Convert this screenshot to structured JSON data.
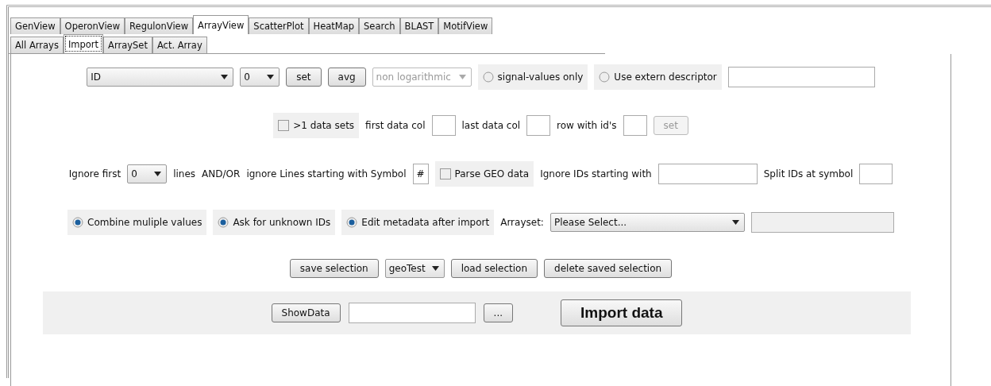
{
  "tabs": [
    {
      "label": "GenView",
      "selected": false
    },
    {
      "label": "OperonView",
      "selected": false
    },
    {
      "label": "RegulonView",
      "selected": false
    },
    {
      "label": "ArrayView",
      "selected": true
    },
    {
      "label": "ScatterPlot",
      "selected": false
    },
    {
      "label": "HeatMap",
      "selected": false
    },
    {
      "label": "Search",
      "selected": false
    },
    {
      "label": "BLAST",
      "selected": false
    },
    {
      "label": "MotifView",
      "selected": false
    }
  ],
  "subtabs": [
    {
      "label": "All Arrays",
      "selected": false
    },
    {
      "label": "Import",
      "selected": true
    },
    {
      "label": "ArraySet",
      "selected": false
    },
    {
      "label": "Act. Array",
      "selected": false
    }
  ],
  "rows": [
    {
      "items": [
        {
          "kind": "dropdown",
          "value": "ID",
          "disabled": false
        },
        {
          "kind": "dropdown",
          "value": "0",
          "disabled": false
        },
        {
          "kind": "button",
          "label": "set",
          "disabled": false
        },
        {
          "kind": "button",
          "label": "avg",
          "disabled": false
        },
        {
          "kind": "dropdown",
          "value": "non logarithmic",
          "disabled": true
        },
        {
          "kind": "radio",
          "label": "signal-values only",
          "selected": false
        },
        {
          "kind": "radio",
          "label": "Use extern descriptor",
          "selected": false
        },
        {
          "kind": "field",
          "disabled": false
        }
      ]
    },
    {
      "items": [
        {
          "kind": "checkbox",
          "label": ">1 data sets",
          "checked": false
        },
        {
          "kind": "label",
          "label": "first data col"
        },
        {
          "kind": "field",
          "disabled": false
        },
        {
          "kind": "label",
          "label": "last data col"
        },
        {
          "kind": "field",
          "disabled": false
        },
        {
          "kind": "label",
          "label": "row with id's"
        },
        {
          "kind": "field",
          "disabled": false
        },
        {
          "kind": "button",
          "label": "set",
          "disabled": true
        }
      ]
    },
    {
      "items": [
        {
          "kind": "label",
          "label": "Ignore first"
        },
        {
          "kind": "dropdown",
          "value": "0",
          "disabled": false
        },
        {
          "kind": "label",
          "label": "lines"
        },
        {
          "kind": "label",
          "label": "AND/OR"
        },
        {
          "kind": "label",
          "label": "ignore Lines starting with Symbol"
        },
        {
          "kind": "field",
          "value": "#",
          "disabled": false
        },
        {
          "kind": "checkbox",
          "label": "Parse GEO data",
          "checked": false
        },
        {
          "kind": "label",
          "label": "Ignore IDs starting with"
        },
        {
          "kind": "field",
          "disabled": false
        },
        {
          "kind": "label",
          "label": "Split IDs at symbol"
        },
        {
          "kind": "field",
          "disabled": false
        }
      ]
    },
    {
      "items": [
        {
          "kind": "radio",
          "label": "Combine muliple values",
          "selected": true
        },
        {
          "kind": "radio",
          "label": "Ask for unknown IDs",
          "selected": true
        },
        {
          "kind": "radio",
          "label": "Edit metadata after import",
          "selected": true
        },
        {
          "kind": "label",
          "label": "Arrayset:"
        },
        {
          "kind": "dropdown",
          "value": "Please Select...",
          "disabled": false
        },
        {
          "kind": "field",
          "disabled": true
        }
      ]
    },
    {
      "items": [
        {
          "kind": "button",
          "label": "save selection",
          "disabled": false
        },
        {
          "kind": "dropdown",
          "value": "geoTest",
          "disabled": false
        },
        {
          "kind": "button",
          "label": "load selection",
          "disabled": false
        },
        {
          "kind": "button",
          "label": "delete saved selection",
          "disabled": false
        }
      ]
    }
  ],
  "bottom_panel": {
    "items": [
      {
        "kind": "button",
        "label": "ShowData",
        "disabled": false
      },
      {
        "kind": "field",
        "disabled": false
      },
      {
        "kind": "button",
        "label": "...",
        "disabled": false
      },
      {
        "kind": "big_button",
        "label": "Import data",
        "disabled": false
      }
    ]
  }
}
